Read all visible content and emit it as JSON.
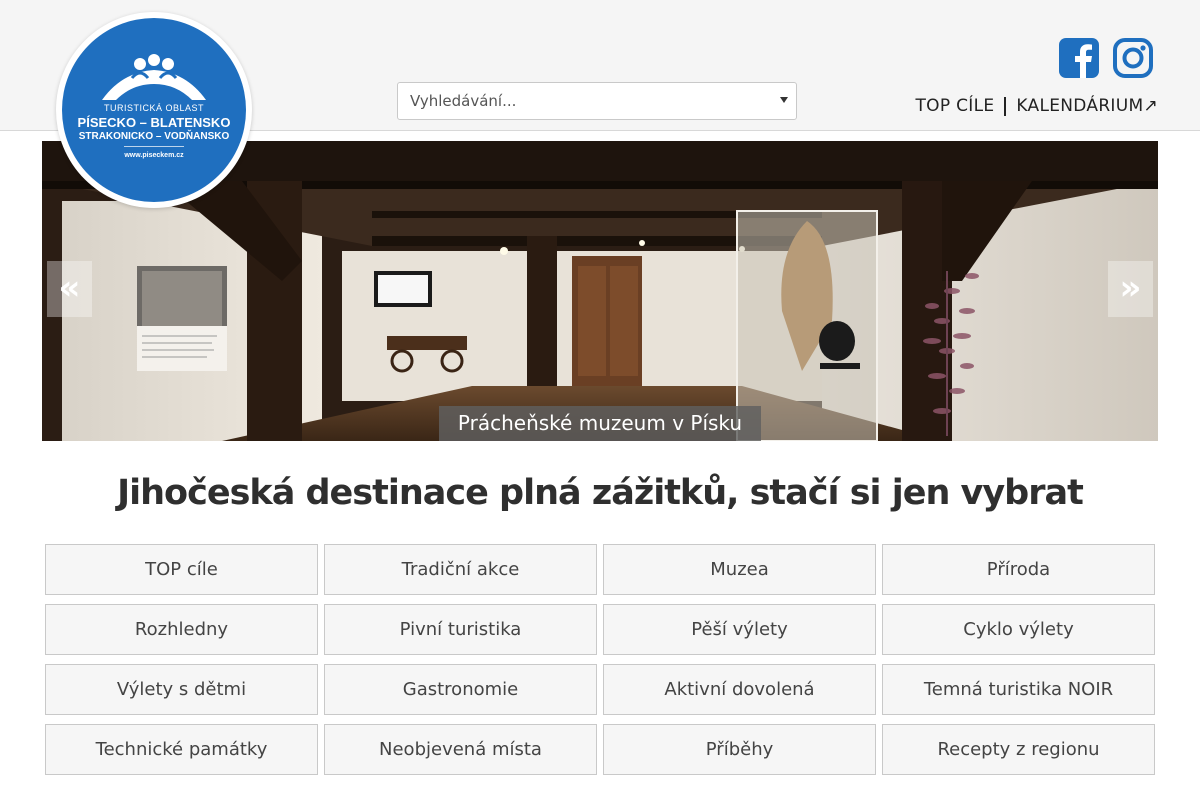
{
  "header": {
    "logo": {
      "line1": "TURISTICKÁ OBLAST",
      "line2": "PÍSECKO – BLATENSKO",
      "line3": "STRAKONICKO – VODŇANSKO",
      "line4": "www.piseckem.cz"
    },
    "search": {
      "placeholder": "Vyhledávání..."
    },
    "social": {
      "facebook": "facebook-icon",
      "instagram": "instagram-icon"
    },
    "nav": {
      "top": "TOP CÍLE",
      "calendar": "KALENDÁRIUM↗"
    }
  },
  "hero": {
    "caption": "Prácheňské muzeum v Písku",
    "prev": "«",
    "next": "»"
  },
  "headline": "Jihočeská destinace plná zážitků, stačí si jen vybrat",
  "categories": [
    "TOP cíle",
    "Tradiční akce",
    "Muzea",
    "Příroda",
    "Rozhledny",
    "Pivní turistika",
    "Pěší výlety",
    "Cyklo výlety",
    "Výlety s dětmi",
    "Gastronomie",
    "Aktivní dovolená",
    "Temná turistika NOIR",
    "Technické památky",
    "Neobjevená místa",
    "Příběhy",
    "Recepty z regionu"
  ],
  "colors": {
    "brand": "#1f6fbf",
    "facebook": "#1f6fbf"
  }
}
